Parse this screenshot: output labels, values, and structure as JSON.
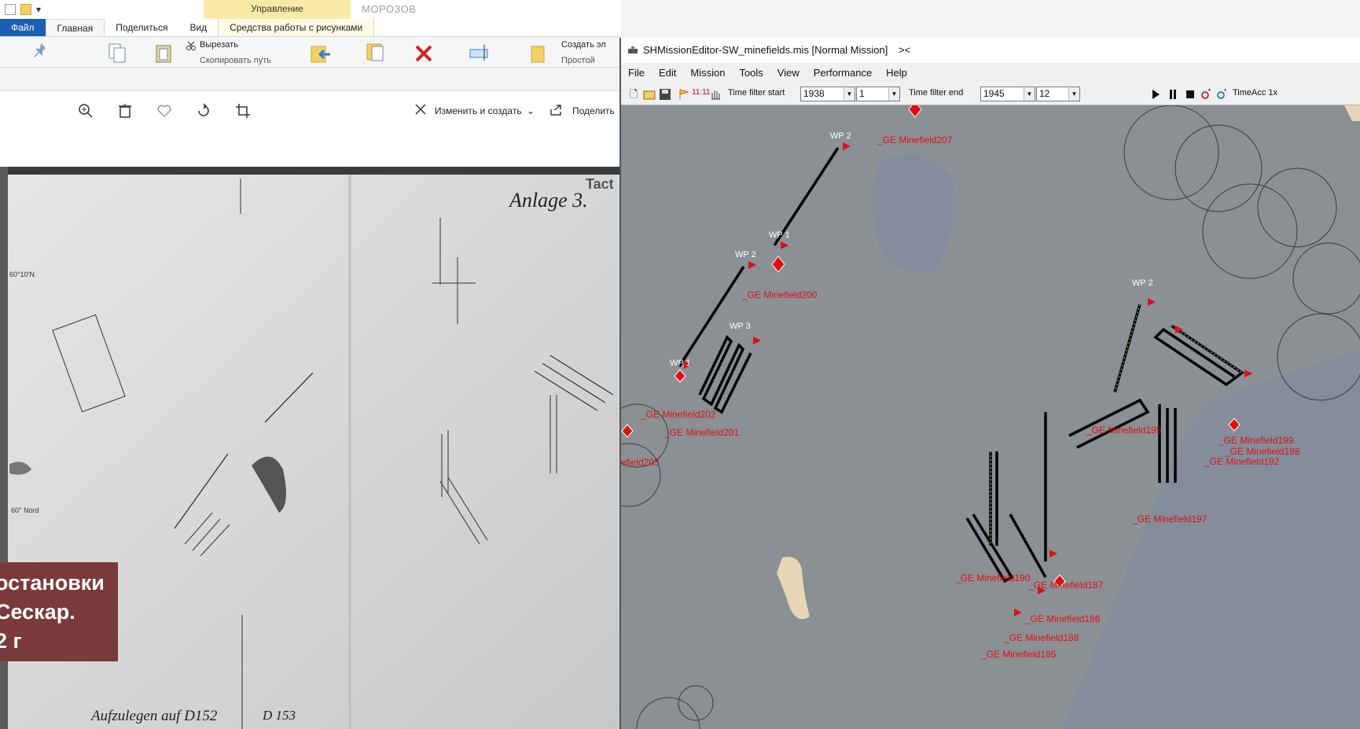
{
  "explorer": {
    "context_group_label": "Управление",
    "folder_name": "МОРОЗОВ",
    "tabs": [
      "Файл",
      "Главная",
      "Поделиться",
      "Вид",
      "Средства работы с рисунками"
    ],
    "ribbon": {
      "cut_label": "Вырезать",
      "copy_path_label": "Скопировать путь",
      "create_label": "Создать эл",
      "simple_label": "Простой"
    }
  },
  "photos": {
    "edit_create_label": "Изменить и создать",
    "share_label": "Поделить",
    "overlay_lines": [
      "остановки",
      "Сескар.",
      "2 г"
    ],
    "scan_texts": {
      "anlage": "Anlage 3.",
      "tact": "Tact",
      "bottom_left": "Aufzulegen auf D152",
      "bottom_mid": "D 153",
      "lat1": "60°10'N",
      "lat2": "60° Nord"
    }
  },
  "editor": {
    "title": "SHMissionEditor-SW_minefields.mis [Normal Mission]",
    "title_suffix": "><",
    "menu": [
      "File",
      "Edit",
      "Mission",
      "Tools",
      "View",
      "Performance",
      "Help"
    ],
    "time_filter_start_label": "Time filter start",
    "time_filter_start_year": "1938",
    "time_filter_start_month": "1",
    "time_filter_end_label": "Time filter end",
    "time_filter_end_year": "1945",
    "time_filter_end_month": "12",
    "clock": "11:11",
    "time_acc_label": "TimeAcc 1x",
    "minefield_labels": [
      "_GE Minefield207",
      "_GE Minefield200",
      "_GE Minefield202",
      "_GE Minefield201",
      "efield203",
      "_GE Minefield199",
      "_GE Minefield198",
      "_GE Minefield192",
      "_GE Minefield197",
      "_GE Minefield187",
      "_GE Minefield186",
      "_GE Minefield188",
      "_GE Minefield185",
      "_GE Minefield195",
      "_GE Minefield190"
    ],
    "waypoint_labels": [
      "WP 2",
      "WP 1",
      "WP 2",
      "WP 1",
      "WP 3",
      "WP 2"
    ]
  }
}
